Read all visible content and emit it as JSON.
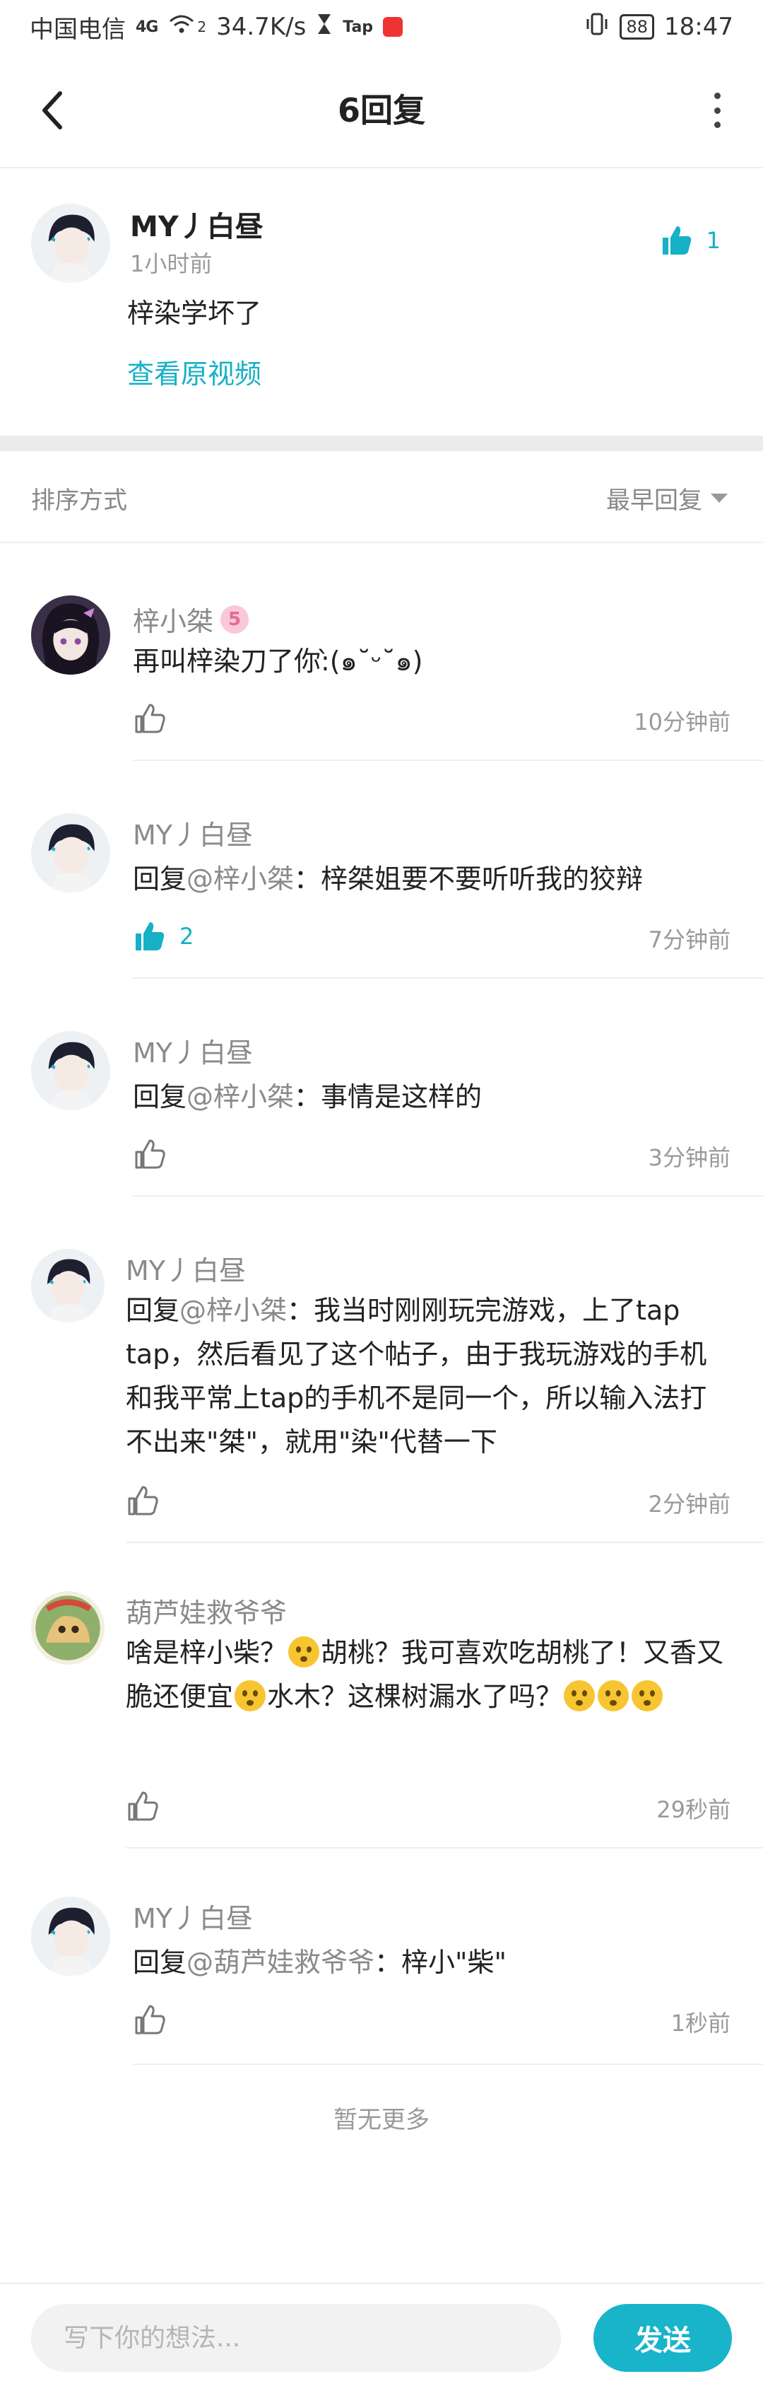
{
  "status_bar": {
    "carrier": "中国电信",
    "network_badge": "4G",
    "wifi_label": "2",
    "speed": "34.7K/s",
    "tap_label": "Tap",
    "battery": "88",
    "time": "18:47"
  },
  "header": {
    "title": "6回复",
    "icons": {
      "back": "back-arrow-icon",
      "more": "more-vertical-icon"
    }
  },
  "original": {
    "author": "MY丿白昼",
    "time": "1小时前",
    "text": "梓染学坏了",
    "view_video_link": "查看原视频",
    "likes": "1"
  },
  "sort": {
    "label": "排序方式",
    "value": "最早回复"
  },
  "replies": [
    {
      "author": "梓小桀",
      "badge": "5",
      "prefix": "",
      "mention": "",
      "sep": "",
      "text": "再叫梓染刀了你:̀(๑˘ᵕ˘๑)",
      "likes": "",
      "time": "10分钟前"
    },
    {
      "author": "MY丿白昼",
      "prefix": "回复",
      "mention": "@梓小桀",
      "sep": "：",
      "text": "梓桀姐要不要听听我的狡辩",
      "likes": "2",
      "time": "7分钟前"
    },
    {
      "author": "MY丿白昼",
      "prefix": "回复",
      "mention": "@梓小桀",
      "sep": "：",
      "text": "事情是这样的",
      "likes": "",
      "time": "3分钟前"
    },
    {
      "author": "MY丿白昼",
      "prefix": "回复",
      "mention": "@梓小桀",
      "sep": "：",
      "text": "我当时刚刚玩完游戏，上了tap tap，然后看见了这个帖子，由于我玩游戏的手机和我平常上tap的手机不是同一个，所以输入法打不出来\"桀\"，就用\"染\"代替一下",
      "likes": "",
      "time": "2分钟前"
    },
    {
      "author": "葫芦娃救爷爷",
      "t1": "啥是梓小柴？",
      "t2": "胡桃？我可喜欢吃胡桃了！又香又脆还便宜",
      "t3": "水木？这棵树漏水了吗？",
      "likes": "",
      "time": "29秒前"
    },
    {
      "author": "MY丿白昼",
      "prefix": "回复",
      "mention": "@葫芦娃救爷爷",
      "sep": "：",
      "text": "梓小\"柴\"",
      "likes": "",
      "time": "1秒前"
    }
  ],
  "no_more": "暂无更多",
  "comment_bar": {
    "placeholder": "写下你的想法...",
    "send_label": "发送"
  },
  "colors": {
    "accent": "#16b0c7",
    "muted": "#8a8a8a",
    "divider": "#efefef"
  }
}
